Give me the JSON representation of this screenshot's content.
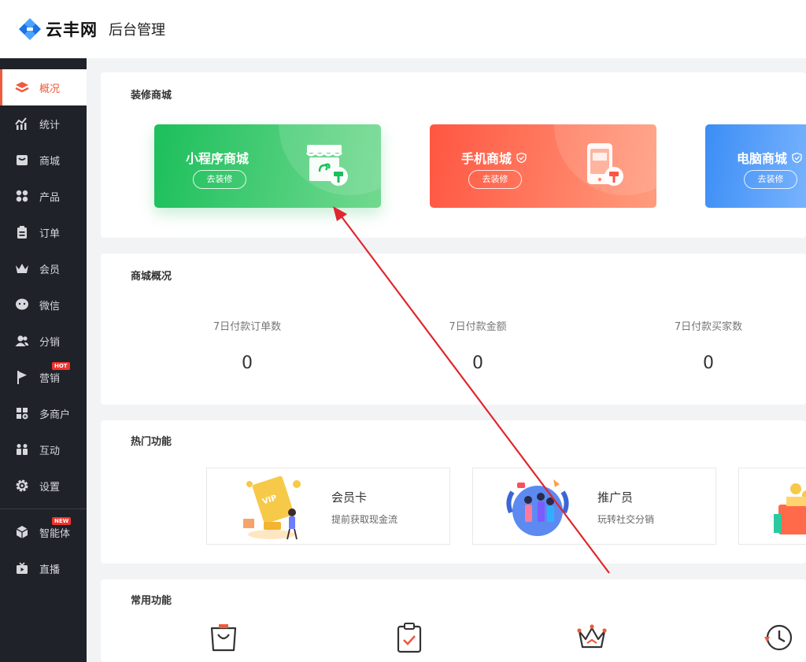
{
  "header": {
    "brand": "云丰网",
    "title": "后台管理"
  },
  "sidebar": {
    "items": [
      {
        "label": "概况",
        "icon": "layers-icon",
        "active": true
      },
      {
        "label": "统计",
        "icon": "chart-icon"
      },
      {
        "label": "商城",
        "icon": "store-icon"
      },
      {
        "label": "产品",
        "icon": "grid-icon"
      },
      {
        "label": "订单",
        "icon": "order-icon"
      },
      {
        "label": "会员",
        "icon": "crown-icon"
      },
      {
        "label": "微信",
        "icon": "wechat-icon"
      },
      {
        "label": "分销",
        "icon": "users-icon"
      },
      {
        "label": "营销",
        "icon": "flag-icon",
        "badge": "HOT"
      },
      {
        "label": "多商户",
        "icon": "merchant-icon"
      },
      {
        "label": "互动",
        "icon": "interact-icon"
      },
      {
        "label": "设置",
        "icon": "gear-icon"
      },
      {
        "label": "智能体",
        "icon": "cube-icon",
        "badge": "NEW"
      },
      {
        "label": "直播",
        "icon": "tv-icon"
      }
    ]
  },
  "decorate": {
    "title": "装修商城",
    "tiles": [
      {
        "name": "小程序商城",
        "button": "去装修",
        "color_from": "#1fc15e",
        "color_to": "#6fd88d"
      },
      {
        "name": "手机商城",
        "button": "去装修",
        "color_from": "#ff5a45",
        "color_to": "#ff9a7a"
      },
      {
        "name": "电脑商城",
        "button": "去装修",
        "color_from": "#3d8ff5",
        "color_to": "#7fb7ff"
      }
    ]
  },
  "overview": {
    "title": "商城概况",
    "stats": [
      {
        "label": "7日付款订单数",
        "value": "0"
      },
      {
        "label": "7日付款金额",
        "value": "0"
      },
      {
        "label": "7日付款买家数",
        "value": "0"
      }
    ]
  },
  "hot": {
    "title": "热门功能",
    "items": [
      {
        "title": "会员卡",
        "desc": "提前获取现金流"
      },
      {
        "title": "推广员",
        "desc": "玩转社交分销"
      }
    ]
  },
  "common": {
    "title": "常用功能"
  },
  "colors": {
    "accent": "#f05a3c",
    "sidebar_bg": "#1f2228",
    "annotation_arrow": "#e0262e"
  }
}
